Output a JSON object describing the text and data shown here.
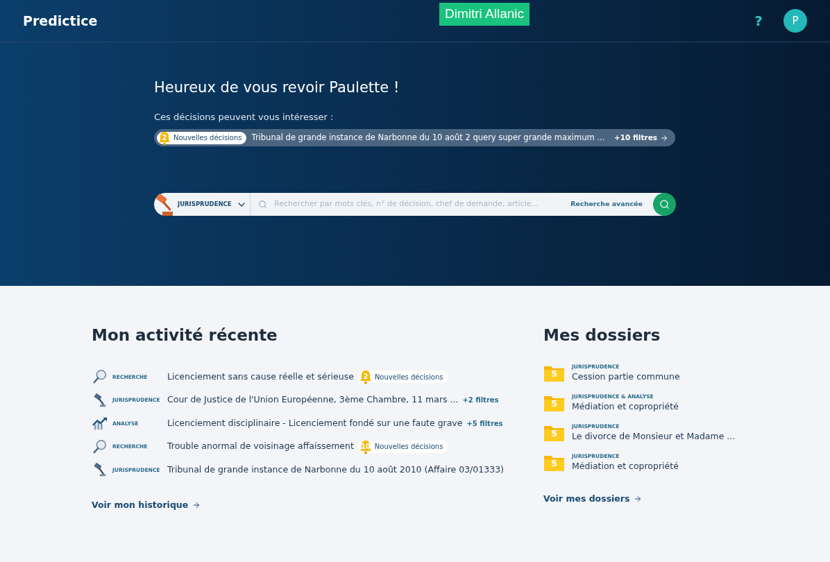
{
  "header": {
    "logo": "Predictice",
    "cursor_label": "Dimitri Allanic",
    "help": "?",
    "avatar": "P"
  },
  "hero": {
    "greeting": "Heureux de vous revoir Paulette !",
    "suggest_label": "Ces décisions peuvent vous intéresser :",
    "suggestion": {
      "count": "2",
      "badge": "Nouvelles décisions",
      "text": "Tribunal de grande instance de Narbonne du 10 août 2 query super grande maximum ...",
      "filters": "+10 filtres"
    },
    "search": {
      "category": "JURISPRUDENCE",
      "placeholder": "Rechercher par mots clés, n° de décision, chef de demande, article...",
      "advanced": "Recherche avancée"
    }
  },
  "activity": {
    "title": "Mon activité récente",
    "items": [
      {
        "kind": "search",
        "type_label": "RECHERCHE",
        "title": "Licenciement sans cause réelle et sérieuse",
        "alert": {
          "count": "2",
          "label": "Nouvelles décisions"
        }
      },
      {
        "kind": "jurisprudence",
        "type_label": "JURISPRUDENCE",
        "title": "Cour de Justice de l'Union Européenne, 3ème Chambre, 11 mars ...",
        "filters": "+2 filtres"
      },
      {
        "kind": "analysis",
        "type_label": "ANALYSE",
        "title": "Licenciement disciplinaire - Licenciement fondé sur une faute grave",
        "filters": "+5 filtres"
      },
      {
        "kind": "search",
        "type_label": "RECHERCHE",
        "title": "Trouble anormal de voisinage affaissement",
        "alert": {
          "count": "10",
          "label": "Nouvelles décisions"
        }
      },
      {
        "kind": "jurisprudence",
        "type_label": "JURISPRUDENCE",
        "title": "Tribunal de grande instance de Narbonne du 10 août 2010 (Affaire 03/01333)"
      }
    ],
    "link": "Voir mon historique"
  },
  "folders": {
    "title": "Mes dossiers",
    "items": [
      {
        "count": "5",
        "type_label": "JURISPRUDENCE",
        "name": "Cession partie commune"
      },
      {
        "count": "5",
        "type_label": "JURISPRUDENCE & ANALYSE",
        "name": "Médiation et copropriété"
      },
      {
        "count": "5",
        "type_label": "JURISPRUDENCE",
        "name": "Le divorce de Monsieur et Madame ..."
      },
      {
        "count": "5",
        "type_label": "JURISPRUDENCE",
        "name": "Médiation et copropriété"
      }
    ],
    "link": "Voir mes dossiers"
  }
}
